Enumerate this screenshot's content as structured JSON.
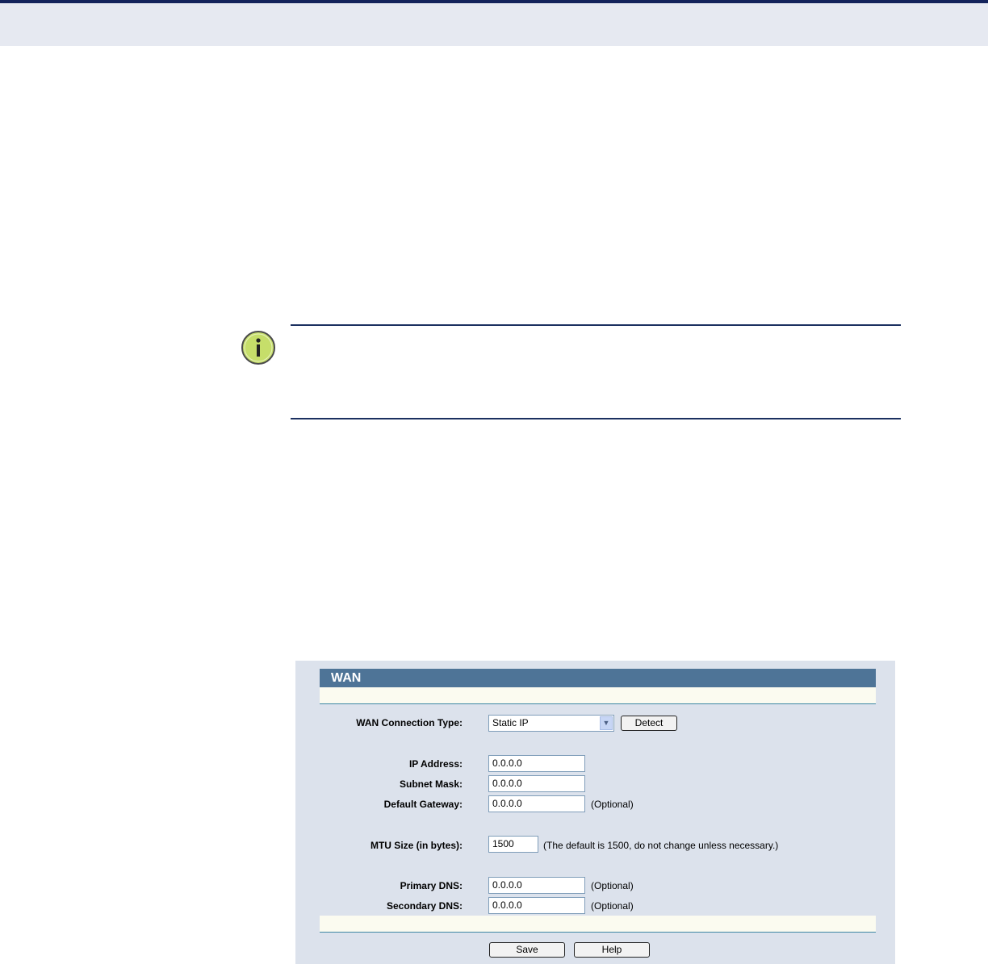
{
  "note": {
    "icon": "info-icon",
    "icon_glyph": "i",
    "icon_color": "#c6de6a"
  },
  "wan_panel": {
    "title": "WAN",
    "connection_type": {
      "label": "WAN Connection Type:",
      "value": "Static IP",
      "detect_label": "Detect"
    },
    "ip_address": {
      "label": "IP Address:",
      "value": "0.0.0.0"
    },
    "subnet_mask": {
      "label": "Subnet Mask:",
      "value": "0.0.0.0"
    },
    "default_gateway": {
      "label": "Default Gateway:",
      "value": "0.0.0.0",
      "hint": "(Optional)"
    },
    "mtu": {
      "label": "MTU Size (in bytes):",
      "value": "1500",
      "hint": "(The default is 1500, do not change unless necessary.)"
    },
    "primary_dns": {
      "label": "Primary DNS:",
      "value": "0.0.0.0",
      "hint": "(Optional)"
    },
    "secondary_dns": {
      "label": "Secondary DNS:",
      "value": "0.0.0.0",
      "hint": "(Optional)"
    },
    "save_label": "Save",
    "help_label": "Help",
    "colors": {
      "title_bar": "#4e7497",
      "panel_bg": "#dce2ec",
      "band": "#fbfbf0"
    }
  }
}
